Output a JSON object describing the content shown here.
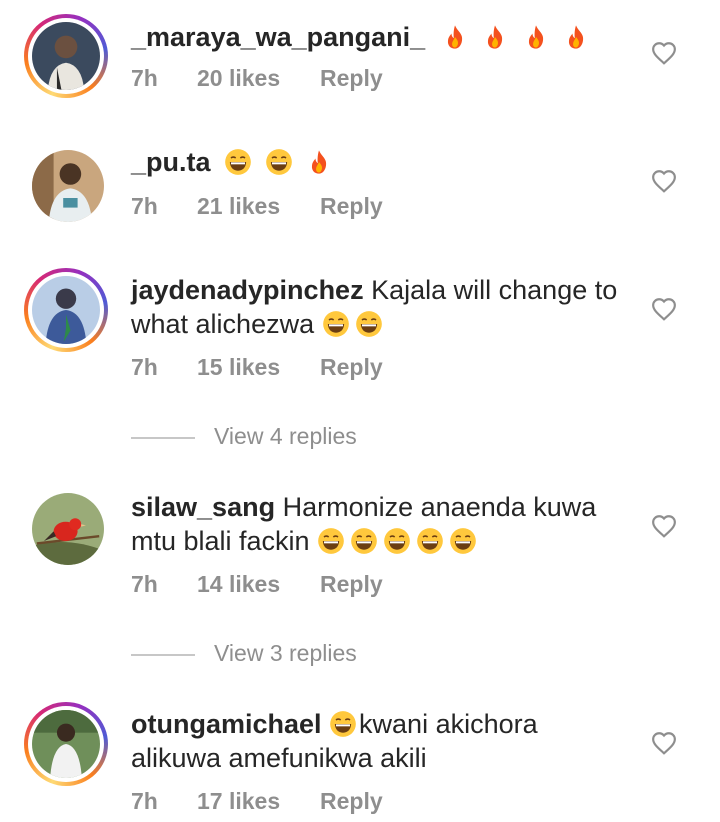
{
  "comments": [
    {
      "username": "_maraya_wa_pangani_",
      "text": "",
      "emoji": [
        "fire",
        "fire",
        "fire",
        "fire"
      ],
      "time": "7h",
      "likes": "20 likes",
      "reply": "Reply",
      "story_ring": true,
      "avatar_color": "#2f3f52"
    },
    {
      "username": "_pu.ta",
      "text": "",
      "emoji": [
        "laugh",
        "laugh",
        "fire"
      ],
      "time": "7h",
      "likes": "21 likes",
      "reply": "Reply",
      "story_ring": false,
      "avatar_color": "#8a6a4a"
    },
    {
      "username": "jaydenadypinchez",
      "text": "Kajala will change to what alichezwa",
      "emoji": [
        "laugh",
        "laugh"
      ],
      "time": "7h",
      "likes": "15 likes",
      "reply": "Reply",
      "story_ring": true,
      "avatar_color": "#9fb7d6",
      "view_replies": "View 4 replies"
    },
    {
      "username": "silaw_sang",
      "text": "Harmonize anaenda kuwa mtu blali fackin",
      "emoji": [
        "laugh",
        "laugh",
        "laugh",
        "laugh",
        "laugh"
      ],
      "time": "7h",
      "likes": "14 likes",
      "reply": "Reply",
      "story_ring": false,
      "avatar_color": "#7a8f5a",
      "view_replies": "View 3 replies"
    },
    {
      "username": "otungamichael",
      "text_before_emoji": "",
      "text": "kwani akichora alikuwa amefunikwa akili",
      "emoji_first": [
        "laugh"
      ],
      "time": "7h",
      "likes": "17 likes",
      "reply": "Reply",
      "story_ring": true,
      "avatar_color": "#5e7d4e"
    }
  ],
  "colors": {
    "text": "#262626",
    "meta": "#8e8e8e",
    "divider": "#c7c7c7"
  }
}
